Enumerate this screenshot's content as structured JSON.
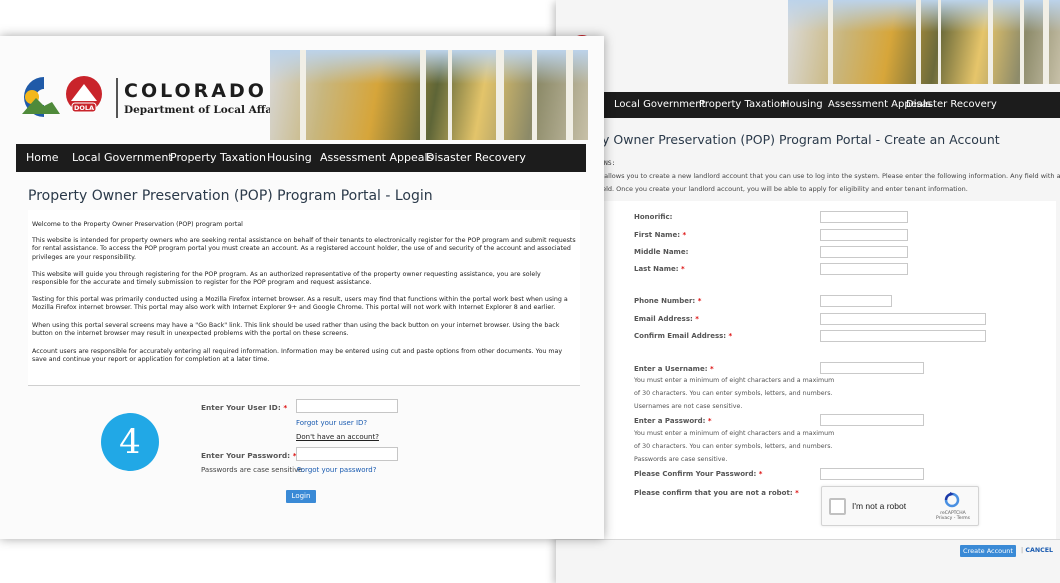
{
  "brand": {
    "name": "COLORADO",
    "department": "Department of Local Affairs",
    "badge": "DOLA"
  },
  "nav_left": [
    "Home",
    "Local Government",
    "Property Taxation",
    "Housing",
    "Assessment Appeals",
    "Disaster Recovery"
  ],
  "nav_right": [
    "Local Government",
    "Property Taxation",
    "Housing",
    "Assessment Appeals",
    "Disaster Recovery"
  ],
  "login": {
    "title": "Property Owner Preservation (POP) Program Portal - Login",
    "paragraphs": [
      "Welcome to the Property Owner Preservation (POP) program portal",
      "This website is intended for property owners who are seeking rental assistance on behalf of their tenants to electronically register for the POP program and submit requests for rental assistance. To access the POP program portal you must create an account. As a registered account holder, the use of and security of the account and associated privileges are your responsibility.",
      "This website will guide you through registering for the POP program. As an authorized representative of the property owner requesting assistance, you are solely responsible for the accurate and timely submission to register for the POP program and request assistance.",
      "Testing for this portal was primarily conducted using a Mozilla Firefox internet browser. As a result, users may find that functions within the portal work best when using a Mozilla Firefox internet browser. This portal may also work with Internet Explorer 9+ and Google Chrome. This portal will not work with Internet Explorer 8 and earlier.",
      "When using this portal several screens may have a \"Go Back\" link. This link should be used rather than using the back button on your internet browser. Using the back button on the internet browser may result in unexpected problems with the portal on these screens.",
      "Account users are responsible for accurately entering all required information. Information may be entered using cut and paste options from other documents. You may save and continue your report or application for completion at a later time."
    ],
    "user_id_label": "Enter Your User ID:",
    "forgot_user_id": "Forgot your user ID?",
    "no_account": "Don't have an account?",
    "password_label": "Enter Your Password:",
    "password_note": "Passwords are case sensitive.",
    "forgot_password": "Forgot your password?",
    "login_button": "Login",
    "required_mark": "*",
    "step_number": "4"
  },
  "create": {
    "title": "rty Owner Preservation (POP) Program Portal - Create an Account",
    "section": "IONS:",
    "instructions": [
      "n allows you to create a new landlord account that you can use to log into the system. Please enter the following information. Any field with a * is a",
      "field. Once you create your landlord account, you will be able to apply for eligibility and enter tenant information."
    ],
    "fields": {
      "honorific": "Honorific:",
      "first_name": "First Name:",
      "middle_name": "Middle Name:",
      "last_name": "Last Name:",
      "phone": "Phone Number:",
      "email": "Email Address:",
      "confirm_email": "Confirm Email Address:",
      "username": "Enter a Username:",
      "username_help": [
        "You must enter a minimum of eight characters and a maximum",
        "of 30 characters. You can enter symbols, letters, and numbers.",
        "Usernames are not case sensitive."
      ],
      "password": "Enter a Password:",
      "password_help": [
        "You must enter a minimum of eight characters and a maximum",
        "of 30 characters. You can enter symbols, letters, and numbers.",
        "Passwords are case sensitive."
      ],
      "confirm_password": "Please Confirm Your Password:",
      "robot": "Please confirm that you are not a robot:"
    },
    "recaptcha_label": "I'm not a robot",
    "recaptcha_brand": "reCAPTCHA",
    "recaptcha_links": "Privacy - Terms",
    "create_button": "Create Account",
    "separator": "|",
    "cancel": "CANCEL",
    "required_mark": "*"
  },
  "colors": {
    "nav_bg": "#1c1c1c",
    "button": "#3a8ad6",
    "link": "#1a5bb0",
    "required": "#dd1111",
    "step_badge": "#21a8e6"
  }
}
